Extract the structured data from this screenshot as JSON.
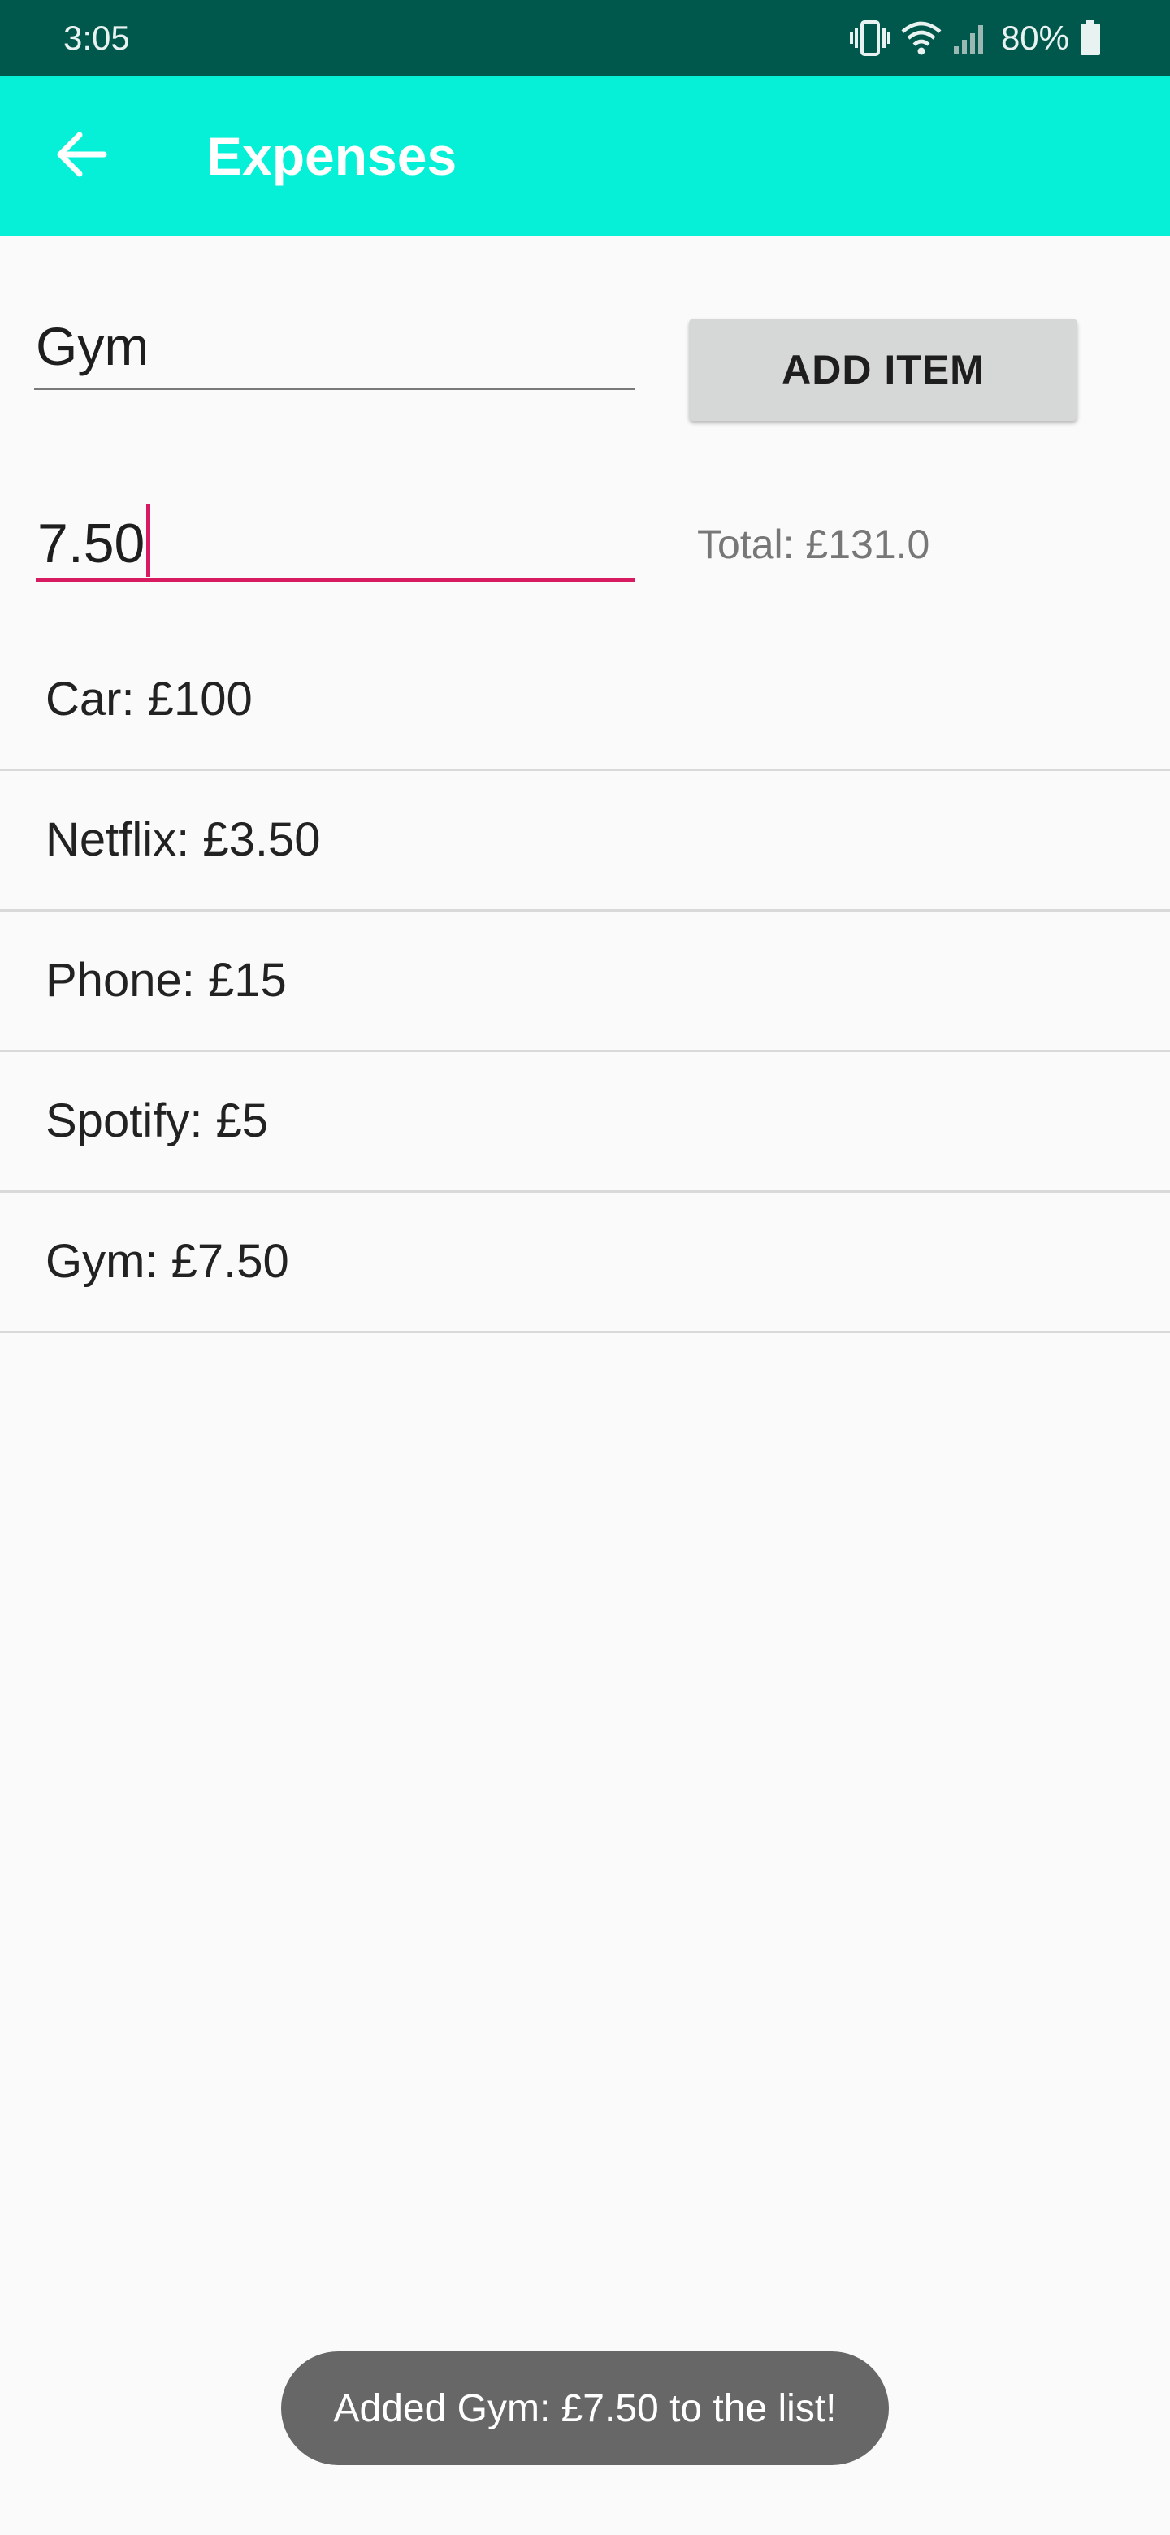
{
  "status_bar": {
    "time": "3:05",
    "battery_percent": "80%",
    "icons": [
      "vibrate-icon",
      "wifi-icon",
      "signal-icon",
      "battery-icon"
    ]
  },
  "app_bar": {
    "title": "Expenses",
    "back_icon": "arrow-back-icon",
    "background_color": "#05f0d6"
  },
  "form": {
    "name_value": "Gym",
    "amount_value": "7.50",
    "add_button_label": "ADD ITEM",
    "total_text": "Total: £131.0"
  },
  "expenses": [
    {
      "label": "Car: £100"
    },
    {
      "label": "Netflix: £3.50"
    },
    {
      "label": "Phone: £15"
    },
    {
      "label": "Spotify: £5"
    },
    {
      "label": "Gym: £7.50"
    }
  ],
  "toast": {
    "message": "Added Gym: £7.50 to the list!"
  },
  "colors": {
    "status_bar": "#00574b",
    "accent": "#d81b60"
  }
}
